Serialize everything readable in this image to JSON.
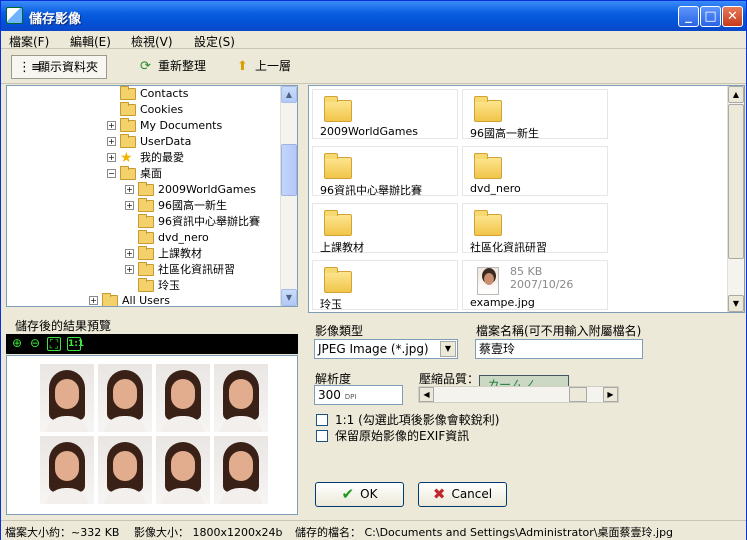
{
  "window": {
    "title": "儲存影像"
  },
  "menu": {
    "items": [
      "檔案(F)",
      "編輯(E)",
      "檢視(V)",
      "設定(S)"
    ]
  },
  "toolbar": {
    "show_folders": "顯示資料夾",
    "refresh": "重新整理",
    "up": "上一層"
  },
  "tree": {
    "items": [
      {
        "label": "Contacts",
        "expand": ""
      },
      {
        "label": "Cookies",
        "expand": ""
      },
      {
        "label": "My Documents",
        "expand": "+"
      },
      {
        "label": "UserData",
        "expand": "+"
      },
      {
        "label": "我的最愛",
        "expand": "+"
      },
      {
        "label": "桌面",
        "expand": "−"
      },
      {
        "label": "2009WorldGames",
        "expand": "+"
      },
      {
        "label": "96國高一新生",
        "expand": "+"
      },
      {
        "label": "96資訊中心舉辦比賽",
        "expand": ""
      },
      {
        "label": "dvd_nero",
        "expand": ""
      },
      {
        "label": "上課教材",
        "expand": "+"
      },
      {
        "label": "社區化資訊研習",
        "expand": "+"
      },
      {
        "label": "玲玉",
        "expand": ""
      },
      {
        "label": "All Users",
        "expand": "+"
      }
    ]
  },
  "files": {
    "items": [
      {
        "label": "2009WorldGames"
      },
      {
        "label": "96國高一新生"
      },
      {
        "label": "96資訊中心舉辦比賽"
      },
      {
        "label": "dvd_nero"
      },
      {
        "label": "上課教材"
      },
      {
        "label": "社區化資訊研習"
      },
      {
        "label": "玲玉"
      },
      {
        "label": "exampe.jpg",
        "size": "85 KB",
        "date": "2007/10/26"
      }
    ]
  },
  "preview": {
    "title": "儲存後的結果預覽"
  },
  "form": {
    "type_label": "影像類型",
    "type_value": "JPEG Image (*.jpg)",
    "filename_label": "檔案名稱(可不用輸入附屬檔名)",
    "filename_value": "蔡壹玲",
    "resolution_label": "解析度",
    "resolution_value": "300",
    "resolution_unit": "DPI",
    "quality_label": "壓縮品質：",
    "quality_hand": "カームノ",
    "check1": "1:1 (勾選此項後影像會較銳利)",
    "check2": "保留原始影像的EXIF資訊",
    "ok": "OK",
    "cancel": "Cancel"
  },
  "status": {
    "file_size": "檔案大小約：~332 KB",
    "image_size": "影像大小：  1800x1200x24b",
    "save_name": "儲存的檔名：  C:\\Documents and Settings\\Administrator\\桌面蔡壹玲.jpg"
  },
  "colors": {
    "title_bar": "#0a5ee0",
    "accent_green": "#3ee53e"
  },
  "icons": [
    "folder-icon",
    "star-icon",
    "zoom-in-icon",
    "zoom-out-icon",
    "fit-icon",
    "actual-size-icon",
    "refresh-icon",
    "up-folder-icon",
    "check-icon",
    "x-icon"
  ]
}
